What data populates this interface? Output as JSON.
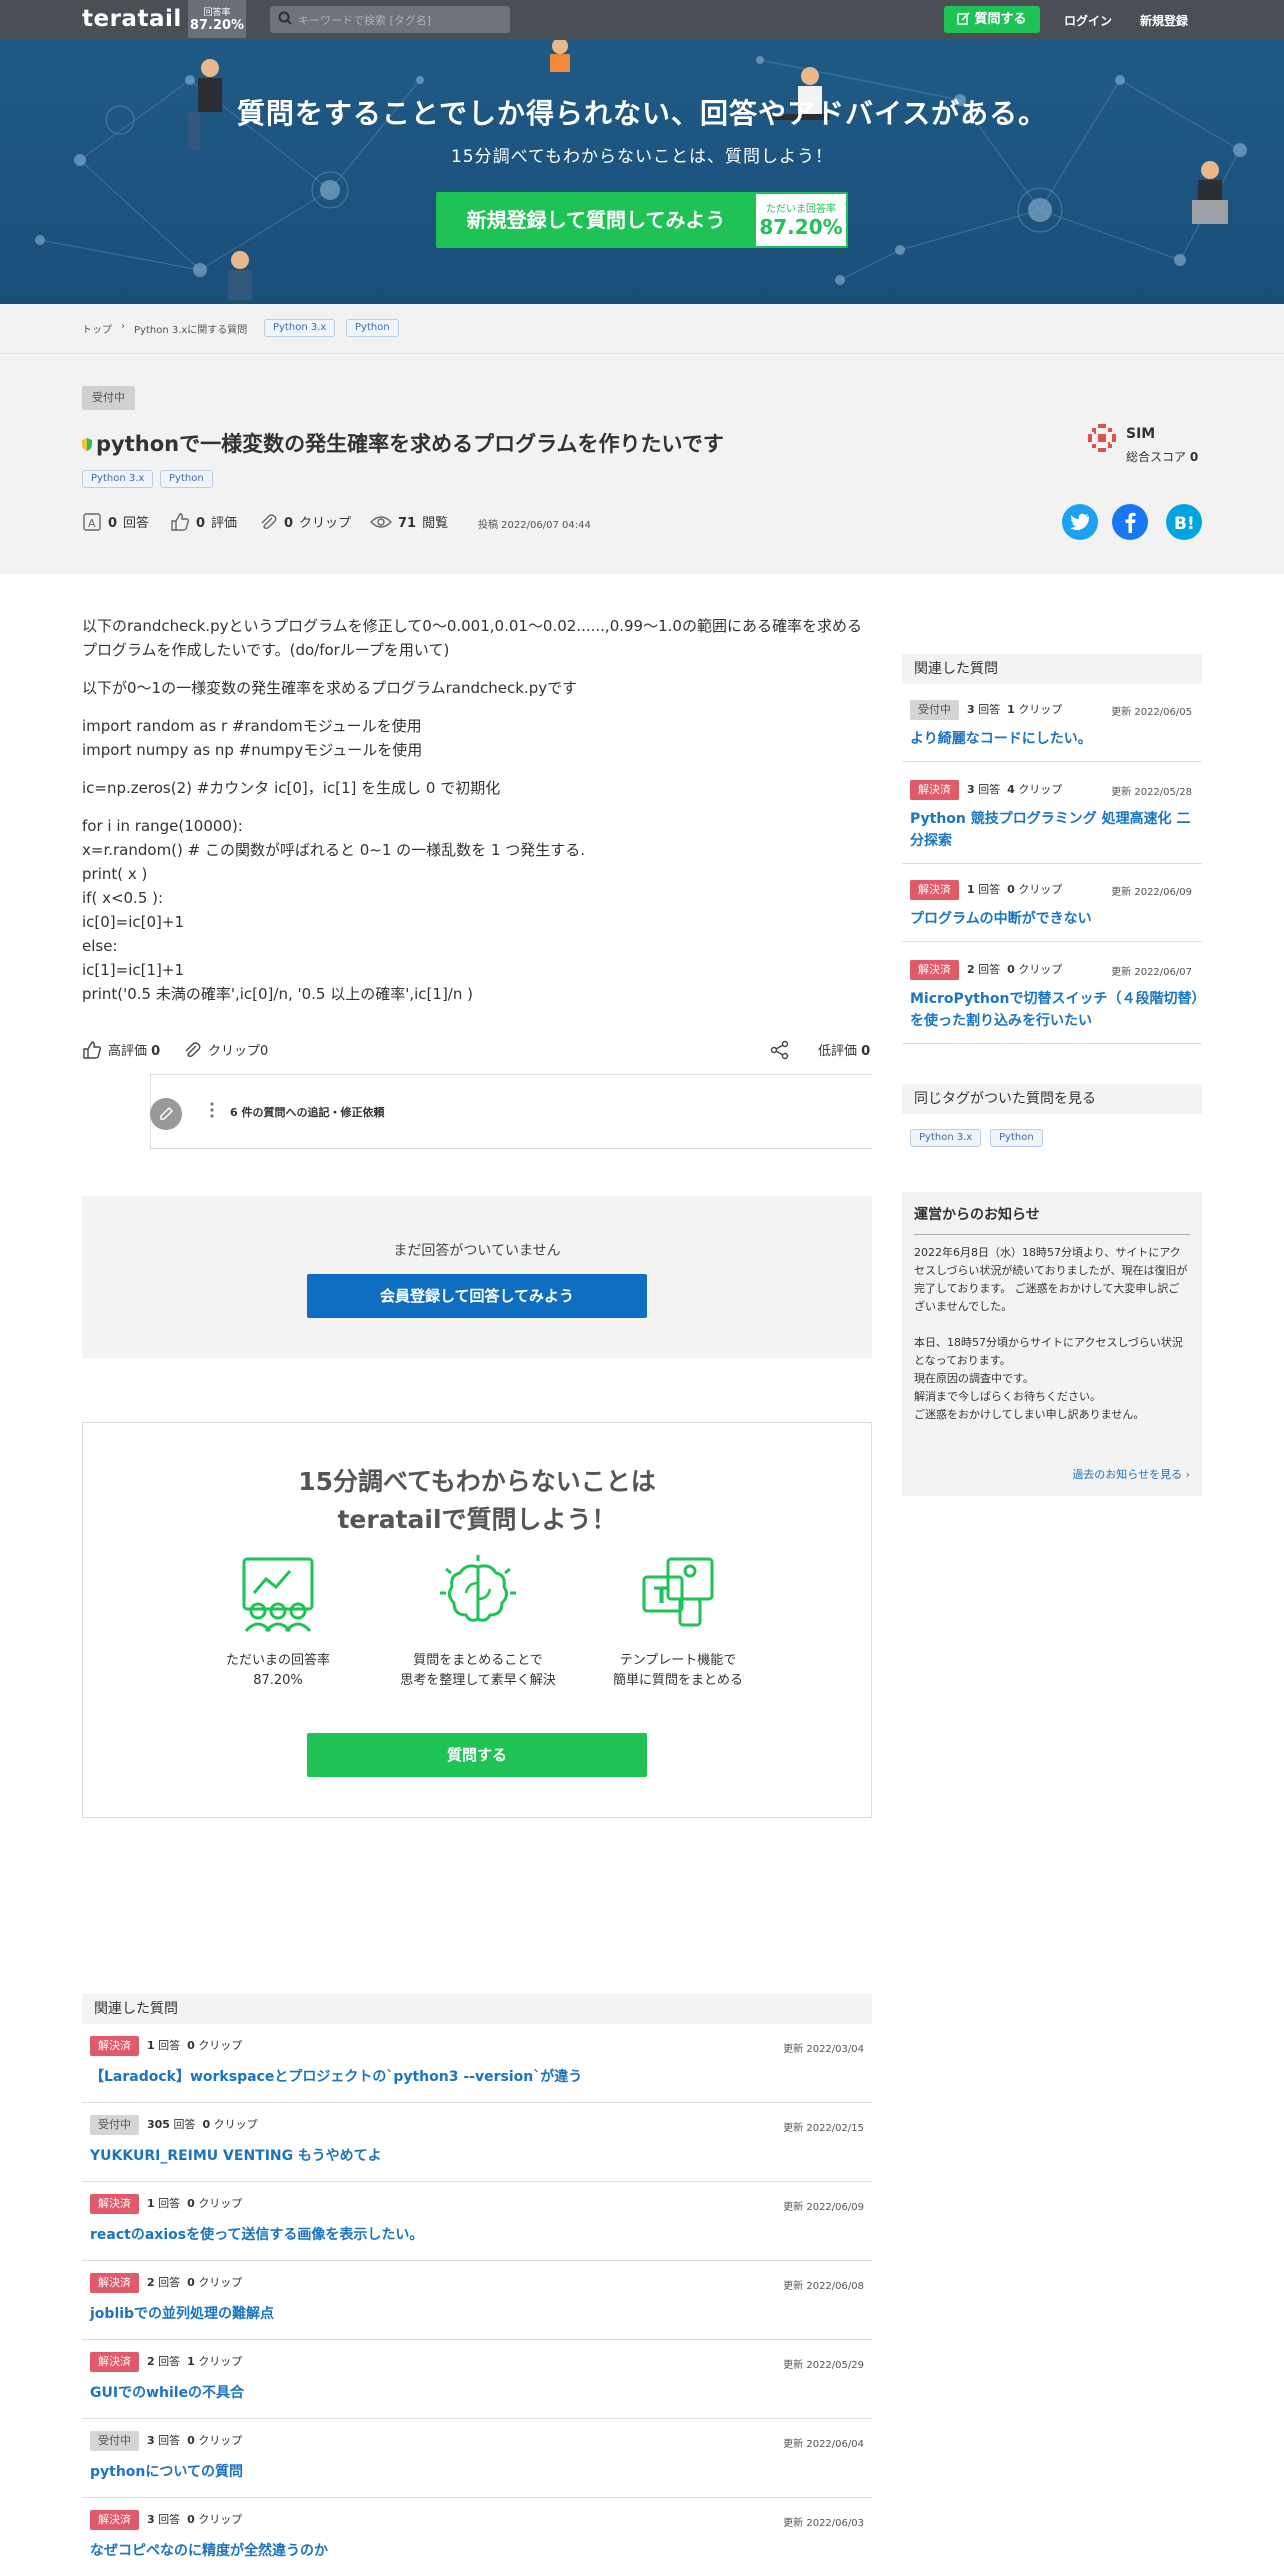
{
  "header": {
    "logo": "teratail",
    "rate_label": "回答率",
    "rate_value": "87.20%",
    "search_placeholder": "キーワードで検索 [タグ名]",
    "ask_label": "質問する",
    "login": "ログイン",
    "signup": "新規登録"
  },
  "hero": {
    "title": "質問をすることでしか得られない、回答やアドバイスがある。",
    "subtitle": "15分調べてもわからないことは、質問しよう！",
    "cta": "新規登録して質問してみよう",
    "rate_label": "ただいま回答率",
    "rate_value": "87.20%"
  },
  "breadcrumb": {
    "top": "トップ",
    "category": "Python 3.xに関する質問",
    "tags": [
      "Python 3.x",
      "Python"
    ]
  },
  "question": {
    "status": "受付中",
    "title": "pythonで一様変数の発生確率を求めるプログラムを作りたいです",
    "tags": [
      "Python 3.x",
      "Python"
    ],
    "answers": "0",
    "answers_label": "回答",
    "ratings": "0",
    "ratings_label": "評価",
    "clips": "0",
    "clips_label": "クリップ",
    "views": "71",
    "views_label": "閲覧",
    "posted": "投稿 2022/06/07 04:44",
    "user": "SIM",
    "score_label": "総合スコア",
    "score": "0",
    "body": [
      "以下のrandcheck.pyというプログラムを修正して0〜0.001,0.01〜0.02......,0.99〜1.0の範囲にある確率を求めるプログラムを作成したいです。(do/forループを用いて)",
      "以下が0〜1の一様変数の発生確率を求めるプログラムrandcheck.pyです",
      "import random as r #randomモジュールを使用\nimport numpy as np #numpyモジュールを使用",
      "ic=np.zeros(2) #カウンタ ic[0]，ic[1] を生成し 0 で初期化",
      "for i in range(10000):\nx=r.random() # この関数が呼ばれると 0~1 の一様乱数を 1 つ発生する.\nprint( x )\nif( x<0.5 ):\nic[0]=ic[0]+1\nelse:\nic[1]=ic[1]+1\nprint('0.5 未満の確率',ic[0]/n, '0.5 以上の確率',ic[1]/n )"
    ],
    "high_rate": "高評価",
    "high_rate_count": "0",
    "clip": "クリップ",
    "clip_count": "0",
    "low_rate": "低評価",
    "low_rate_count": "0",
    "edit_requests": "6 件の質問への追記・修正依頼"
  },
  "no_answer": {
    "text": "まだ回答がついていません",
    "button": "会員登録して回答してみよう"
  },
  "promo": {
    "heading_1": "15分調べてもわからないことは",
    "heading_2": "teratailで質問しよう！",
    "feature_1a": "ただいまの回答率",
    "feature_1b": "87.20%",
    "feature_2a": "質問をまとめることで",
    "feature_2b": "思考を整理して素早く解決",
    "feature_3a": "テンプレート機能で",
    "feature_3b": "簡単に質問をまとめる",
    "button": "質問する"
  },
  "sidebar": {
    "related_title": "関連した質問",
    "related": [
      {
        "status": "受付中",
        "answers": "3",
        "clips": "1",
        "updated": "更新 2022/06/05",
        "title": "より綺麗なコードにしたい。"
      },
      {
        "status": "解決済",
        "answers": "3",
        "clips": "4",
        "updated": "更新 2022/05/28",
        "title": "Python 競技プログラミング 処理高速化 二分探索"
      },
      {
        "status": "解決済",
        "answers": "1",
        "clips": "0",
        "updated": "更新 2022/06/09",
        "title": "プログラムの中断ができない"
      },
      {
        "status": "解決済",
        "answers": "2",
        "clips": "0",
        "updated": "更新 2022/06/07",
        "title": "MicroPythonで切替スイッチ（４段階切替）を使った割り込みを行いたい"
      }
    ],
    "answers_label": "回答",
    "clips_label": "クリップ",
    "same_tag_title": "同じタグがついた質問を見る",
    "same_tags": [
      "Python 3.x",
      "Python"
    ],
    "notice_title": "運営からのお知らせ",
    "notice_p1": "2022年6月8日（水）18時57分頃より、サイトにアクセスしづらい状況が続いておりましたが、現在は復旧が完了しております。 ご迷惑をおかけして大変申し訳ございませんでした。",
    "notice_p2": "本日、18時57分頃からサイトにアクセスしづらい状況となっております。\n現在原因の調査中です。\n解消まで今しばらくお待ちください。\nご迷惑をおかけしてしまい申し訳ありません。",
    "notice_link": "過去のお知らせを見る"
  },
  "bottom_related": {
    "title": "関連した質問",
    "items": [
      {
        "status": "解決済",
        "answers": "1",
        "clips": "0",
        "updated": "更新 2022/03/04",
        "title": "【Laradock】workspaceとプロジェクトの`python3 --version`が違う"
      },
      {
        "status": "受付中",
        "answers": "305",
        "clips": "0",
        "updated": "更新 2022/02/15",
        "title": "YUKKURI_REIMU VENTING もうやめてよ"
      },
      {
        "status": "解決済",
        "answers": "1",
        "clips": "0",
        "updated": "更新 2022/06/09",
        "title": "reactのaxiosを使って送信する画像を表示したい。"
      },
      {
        "status": "解決済",
        "answers": "2",
        "clips": "0",
        "updated": "更新 2022/06/08",
        "title": "joblibでの並列処理の難解点"
      },
      {
        "status": "解決済",
        "answers": "2",
        "clips": "1",
        "updated": "更新 2022/05/29",
        "title": "GUIでのwhileの不具合"
      },
      {
        "status": "受付中",
        "answers": "3",
        "clips": "0",
        "updated": "更新 2022/06/04",
        "title": "pythonについての質問"
      },
      {
        "status": "解決済",
        "answers": "3",
        "clips": "0",
        "updated": "更新 2022/06/03",
        "title": "なぜコピペなのに精度が全然違うのか"
      }
    ]
  },
  "colors": {
    "brand_green": "#1ec255",
    "link_blue": "#1a74c0",
    "resolved_red": "#e05a6a",
    "header_gray": "#4a4e55",
    "hero_blue": "#1f5a86"
  }
}
